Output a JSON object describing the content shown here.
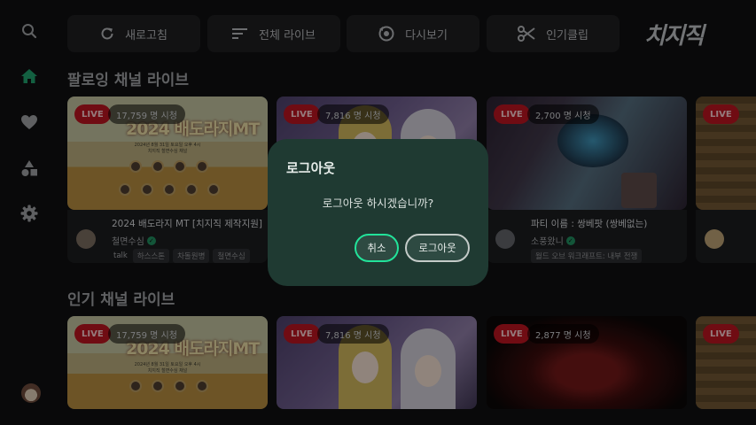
{
  "nav": {
    "items": [
      {
        "icon": "search-icon"
      },
      {
        "icon": "home-icon",
        "active": true
      },
      {
        "icon": "heart-icon"
      },
      {
        "icon": "category-icon"
      },
      {
        "icon": "gear-icon"
      }
    ]
  },
  "topbar": {
    "buttons": [
      {
        "label": "새로고침",
        "icon": "refresh-icon"
      },
      {
        "label": "전체 라이브",
        "icon": "list-icon"
      },
      {
        "label": "다시보기",
        "icon": "replay-icon"
      },
      {
        "label": "인기클립",
        "icon": "scissors-icon"
      }
    ],
    "logo": "치지직"
  },
  "sections": [
    {
      "title": "팔로잉 채널 라이브",
      "cards": [
        {
          "live": "LIVE",
          "viewers": "17,759 명 시청",
          "title": "2024 배도라지 MT [치지직 제작지원]",
          "channel": "철면수심",
          "tags": [
            "talk",
            "하스스톤",
            "차돌원병",
            "철면수심"
          ],
          "thumb_title": "2024 배도라지MT",
          "thumb_sub": "2024년 8월 31일 토요일 오후 4시\n치지직 철면수심 채널"
        },
        {
          "live": "LIVE",
          "viewers": "7,816 명 시청"
        },
        {
          "live": "LIVE",
          "viewers": "2,700 명 시청",
          "title": "파티 이름 : 쌍베팟 (쌍베없는)",
          "channel": "소풍왔니",
          "tags": [
            "월드 오브 워크래프트: 내부 전쟁"
          ]
        },
        {
          "live": "LIVE"
        }
      ]
    },
    {
      "title": "인기 채널 라이브",
      "cards": [
        {
          "live": "LIVE",
          "viewers": "17,759 명 시청",
          "thumb_title": "2024 배도라지MT",
          "thumb_sub": "2024년 8월 31일 토요일 오후 4시\n치지직 철면수심 채널"
        },
        {
          "live": "LIVE",
          "viewers": "7,816 명 시청"
        },
        {
          "live": "LIVE",
          "viewers": "2,877 명 시청"
        },
        {
          "live": "LIVE"
        }
      ]
    }
  ],
  "dialog": {
    "title": "로그아웃",
    "message": "로그아웃 하시겠습니까?",
    "cancel_label": "취소",
    "confirm_label": "로그아웃"
  },
  "colors": {
    "accent": "#22e39a",
    "live": "#b5141f",
    "dialog_bg": "#1f3a32"
  }
}
